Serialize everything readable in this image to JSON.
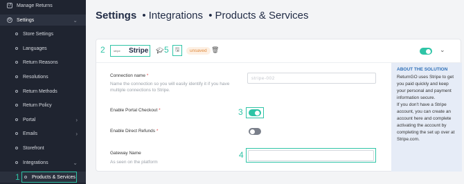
{
  "sidebar": {
    "manage_returns": "Manage Returns",
    "settings": "Settings",
    "items": [
      {
        "label": "Store Settings"
      },
      {
        "label": "Languages"
      },
      {
        "label": "Return Reasons"
      },
      {
        "label": "Resolutions"
      },
      {
        "label": "Return Methods"
      },
      {
        "label": "Return Policy"
      },
      {
        "label": "Portal"
      },
      {
        "label": "Emails"
      },
      {
        "label": "Storefront"
      },
      {
        "label": "Integrations"
      },
      {
        "label": "Products & Services"
      }
    ]
  },
  "header": {
    "title_main": "Settings",
    "crumb_1": "Integrations",
    "crumb_2": "Products & Services",
    "separator": "•"
  },
  "card": {
    "provider_name": "Stripe",
    "provider_logo_text": "stripe",
    "status_badge": "unsaved",
    "connection_enabled": true
  },
  "form": {
    "connection_name_label": "Connection name",
    "connection_name_hint": "Name the connection so you will easily identify it if you have multiple connections to Stripe.",
    "connection_name_value": "stripe-002",
    "portal_checkout_label": "Enable Portal Checkout",
    "portal_checkout_on": true,
    "direct_refunds_label": "Enable Direct Refunds",
    "direct_refunds_on": false,
    "gateway_name_label": "Gateway Name",
    "gateway_name_hint": "As seen on the platform",
    "gateway_name_value": "",
    "required_mark": "*"
  },
  "about": {
    "title": "ABOUT THE SOLUTION",
    "text_1": "ReturnGO uses Stripe to get you paid quickly and keep your personal and payment information secure.",
    "text_2": "If you don't have a Stripe account, you can create an account here and complete activating the account by completing the set up over at Stripe.com."
  },
  "annotations": {
    "n1": "1",
    "n2": "2",
    "n3": "3",
    "n4": "4",
    "n5": "5"
  },
  "colors": {
    "accent": "#2ec4a6",
    "sidebar_bg": "#1f2430",
    "about_bg": "#e6ecf7",
    "badge": "#e08a3c"
  }
}
